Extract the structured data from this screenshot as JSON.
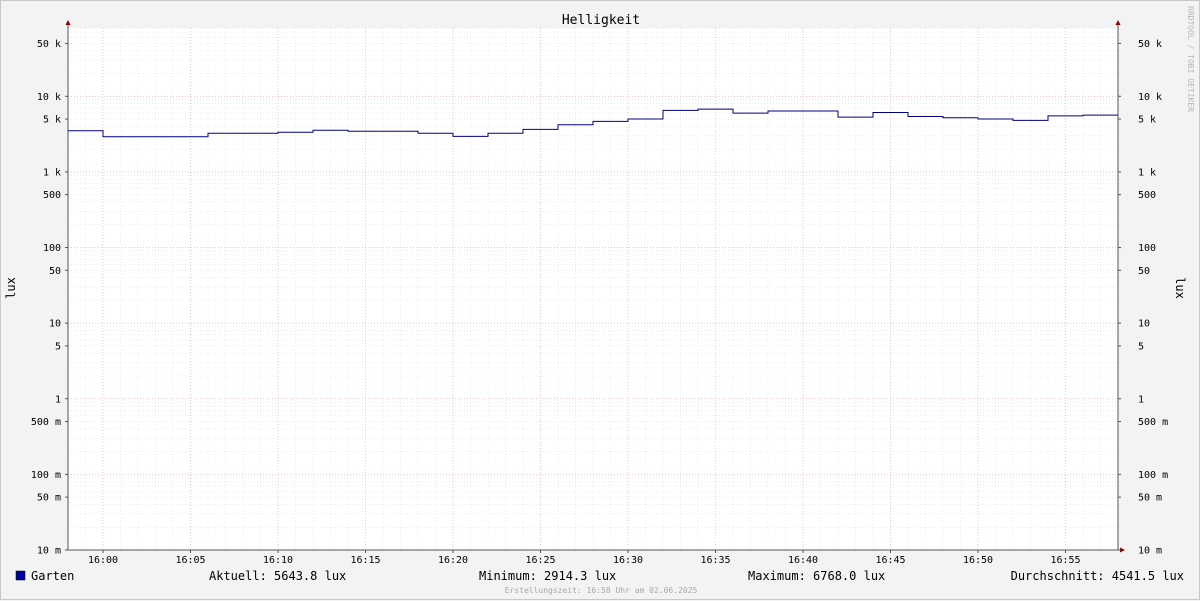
{
  "chart_data": {
    "type": "line",
    "title": "Helligkeit",
    "ylabel": "lux",
    "y_scale": "log",
    "ylim": [
      0.01,
      80000
    ],
    "xlim": [
      "15:58",
      "16:58"
    ],
    "x_ticks": [
      "16:00",
      "16:05",
      "16:10",
      "16:15",
      "16:20",
      "16:25",
      "16:30",
      "16:35",
      "16:40",
      "16:45",
      "16:50",
      "16:55"
    ],
    "y_ticks": [
      {
        "value": 50000,
        "label": "50 k"
      },
      {
        "value": 10000,
        "label": "10 k"
      },
      {
        "value": 5000,
        "label": "5 k"
      },
      {
        "value": 1000,
        "label": "1 k"
      },
      {
        "value": 500,
        "label": "500"
      },
      {
        "value": 100,
        "label": "100"
      },
      {
        "value": 50,
        "label": "50"
      },
      {
        "value": 10,
        "label": "10"
      },
      {
        "value": 5,
        "label": "5"
      },
      {
        "value": 1,
        "label": "1"
      },
      {
        "value": 0.5,
        "label": "500 m"
      },
      {
        "value": 0.1,
        "label": "100 m"
      },
      {
        "value": 0.05,
        "label": "50 m"
      },
      {
        "value": 0.01,
        "label": "10 m"
      }
    ],
    "grid": true,
    "series": [
      {
        "name": "Garten",
        "color": "#000080",
        "step": true,
        "x": [
          "15:58",
          "16:00",
          "16:02",
          "16:04",
          "16:06",
          "16:08",
          "16:10",
          "16:12",
          "16:14",
          "16:16",
          "16:18",
          "16:20",
          "16:22",
          "16:24",
          "16:26",
          "16:28",
          "16:30",
          "16:32",
          "16:34",
          "16:36",
          "16:38",
          "16:40",
          "16:42",
          "16:44",
          "16:46",
          "16:48",
          "16:50",
          "16:52",
          "16:54",
          "16:56",
          "16:58"
        ],
        "values": [
          3500,
          2914.3,
          2914.3,
          2914.3,
          3250,
          3250,
          3350,
          3550,
          3450,
          3450,
          3250,
          2950,
          3250,
          3650,
          4200,
          4650,
          5000,
          6500,
          6768,
          6000,
          6400,
          6400,
          5300,
          6100,
          5400,
          5200,
          5000,
          4800,
          5500,
          5643.8,
          5643.8
        ]
      }
    ],
    "legend_placement": "bottom-left",
    "watermark": "RRDTOOL / TOBI OETIKER",
    "legend": {
      "swatch_color": "#0000a0",
      "name": "Garten",
      "aktuell": "Aktuell: 5643.8 lux",
      "minimum": "Minimum: 2914.3 lux",
      "maximum": "Maximum: 6768.0 lux",
      "durchschnitt": "Durchschnitt: 4541.5 lux"
    },
    "footer": "Erstellungszeit: 16:58 Uhr am 02.06.2025"
  }
}
